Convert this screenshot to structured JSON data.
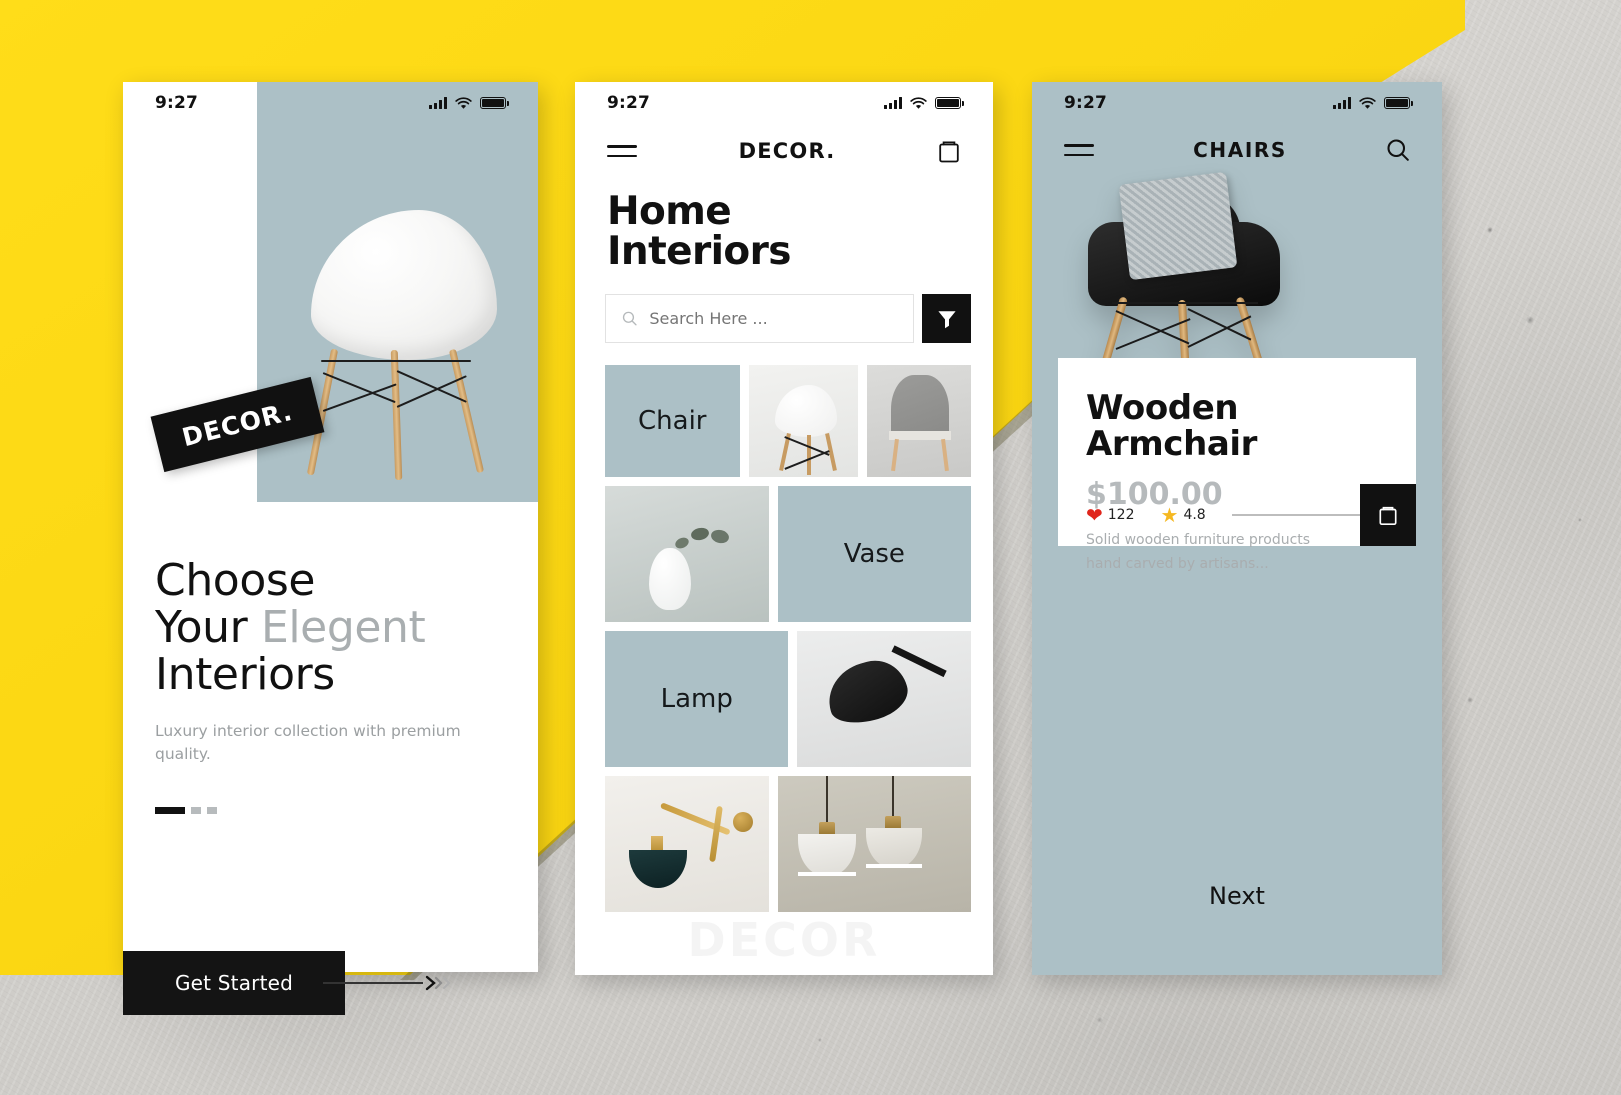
{
  "theme": {
    "yellow": "#fcd713",
    "sage": "#acc0c6",
    "ink": "#111111",
    "muted_text": "#a9adaf",
    "heart_red": "#e0251b",
    "star_gold": "#f5b821",
    "concrete": "#d4d2ce"
  },
  "screen1": {
    "status": {
      "time": "9:27",
      "signal_icon": "cellular-signal-icon",
      "wifi_icon": "wifi-icon",
      "battery_icon": "battery-full-icon"
    },
    "brand_tag": "DECOR.",
    "hero_image_alt": "white-eames-chair",
    "headline": {
      "line1": "Choose",
      "line2_strong": "Your",
      "line2_muted": "Elegent",
      "line3": "Interiors"
    },
    "subtext": "Luxury interior collection with premium quality.",
    "pagination": {
      "total": 3,
      "active_index": 0
    },
    "cta": {
      "label": "Get Started",
      "arrow_icon": "chevron-right-triple-icon"
    }
  },
  "screen2": {
    "status": {
      "time": "9:27",
      "signal_icon": "cellular-signal-icon",
      "wifi_icon": "wifi-icon",
      "battery_icon": "battery-full-icon"
    },
    "appbar": {
      "menu_icon": "hamburger-menu-icon",
      "title": "DECOR.",
      "cart_icon": "shopping-bag-icon"
    },
    "page_title": {
      "line1": "Home",
      "line2": "Interiors"
    },
    "search": {
      "placeholder": "Search Here ...",
      "value": "",
      "search_icon": "search-icon",
      "filter_icon": "filter-funnel-icon"
    },
    "grid_rows": [
      [
        {
          "type": "label",
          "label": "Chair"
        },
        {
          "type": "photo",
          "alt": "white-molded-chair"
        },
        {
          "type": "photo",
          "alt": "grey-upholstered-armchair"
        }
      ],
      [
        {
          "type": "photo",
          "alt": "white-vase-with-eucalyptus"
        },
        {
          "type": "label",
          "label": "Vase"
        }
      ],
      [
        {
          "type": "label",
          "label": "Lamp"
        },
        {
          "type": "photo",
          "alt": "black-desk-lamp"
        }
      ],
      [
        {
          "type": "photo",
          "alt": "brass-wall-sconce-lamp"
        },
        {
          "type": "photo",
          "alt": "white-pendant-lights"
        }
      ]
    ],
    "watermark": "DECOR"
  },
  "screen3": {
    "status": {
      "time": "9:27",
      "signal_icon": "cellular-signal-icon",
      "wifi_icon": "wifi-icon",
      "battery_icon": "battery-full-icon"
    },
    "appbar": {
      "menu_icon": "hamburger-menu-icon",
      "title": "CHAIRS",
      "search_icon": "search-icon"
    },
    "hero_image_alt": "black-armchair-with-knit-cushion",
    "product": {
      "name_line1": "Wooden",
      "name_line2": "Armchair",
      "price": "$100.00",
      "description_line1": "Solid wooden furniture products",
      "description_line2": "hand carved by artisans...",
      "likes": "122",
      "rating": "4.8",
      "heart_icon": "heart-filled-icon",
      "star_icon": "star-filled-icon",
      "add_to_bag_icon": "shopping-bag-icon"
    },
    "next_label": "Next"
  }
}
